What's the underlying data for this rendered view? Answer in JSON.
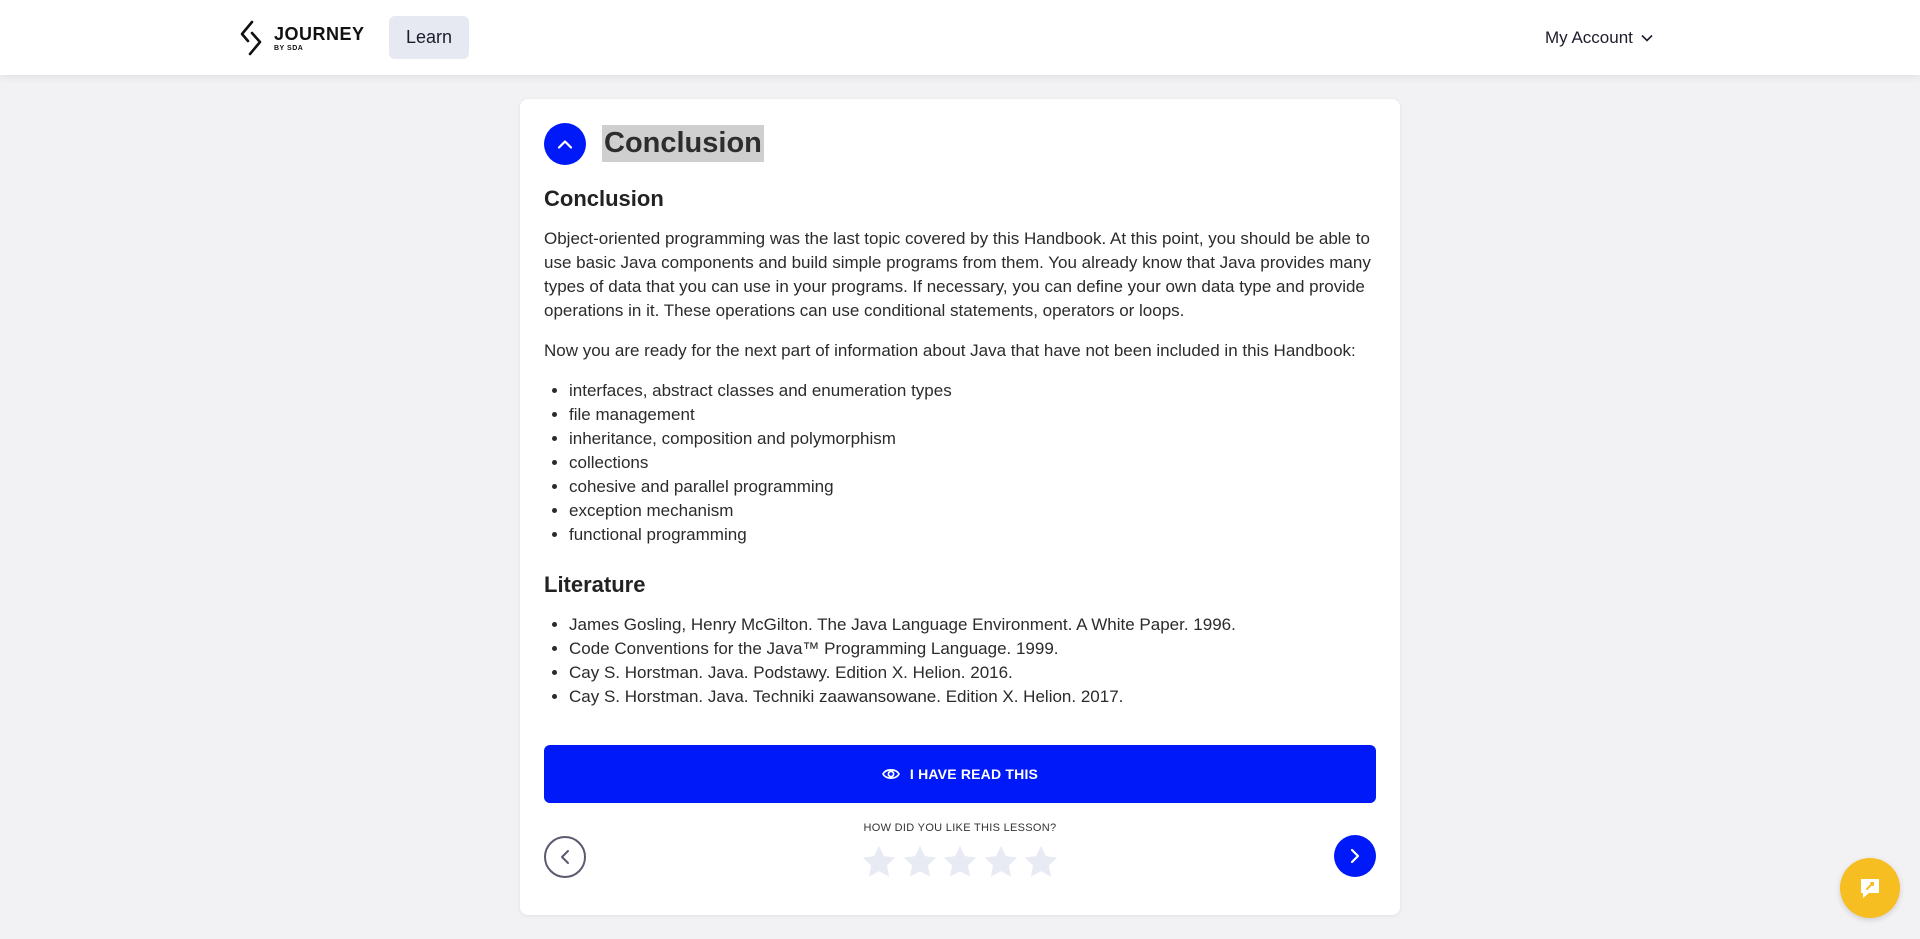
{
  "header": {
    "logo_main": "JOURNEY",
    "logo_sub": "BY SDA",
    "learn_label": "Learn",
    "account_label": "My Account"
  },
  "lesson": {
    "header_title": "Conclusion",
    "section_title": "Conclusion",
    "paragraph1": "Object-oriented programming was the last topic covered by this Handbook. At this point, you should be able to use basic Java components and build simple programs from them. You already know that Java provides many types of data that you can use in your programs. If necessary, you can define your own data type and provide operations in it. These operations can use conditional statements, operators or loops.",
    "paragraph2": "Now you are ready for the next part of information about Java that have not been included in this Handbook:",
    "topics": [
      "interfaces, abstract classes and enumeration types",
      "file management",
      "inheritance, composition and polymorphism",
      "collections",
      "cohesive and parallel programming",
      "exception mechanism",
      "functional programming"
    ],
    "literature_title": "Literature",
    "literature": [
      "James Gosling, Henry McGilton. The Java Language Environment. A White Paper. 1996.",
      "Code Conventions for the Java™ Programming Language. 1999.",
      "Cay S. Horstman. Java. Podstawy. Edition X. Helion. 2016.",
      "Cay S. Horstman. Java. Techniki zaawansowane. Edition X. Helion. 2017."
    ]
  },
  "footer": {
    "read_button_label": "I HAVE READ THIS",
    "rating_question": "HOW DID YOU LIKE THIS LESSON?",
    "rating_max": 5,
    "rating_value": 0
  },
  "colors": {
    "accent": "#0019f8",
    "chat": "#f6be21",
    "star_empty": "#e8eaf4"
  },
  "icons": {
    "collapse": "chevron-up-icon",
    "account": "chevron-down-icon",
    "read": "eye-icon",
    "prev": "chevron-left-icon",
    "next": "chevron-right-icon",
    "chat": "chat-icon",
    "star": "star-icon"
  }
}
